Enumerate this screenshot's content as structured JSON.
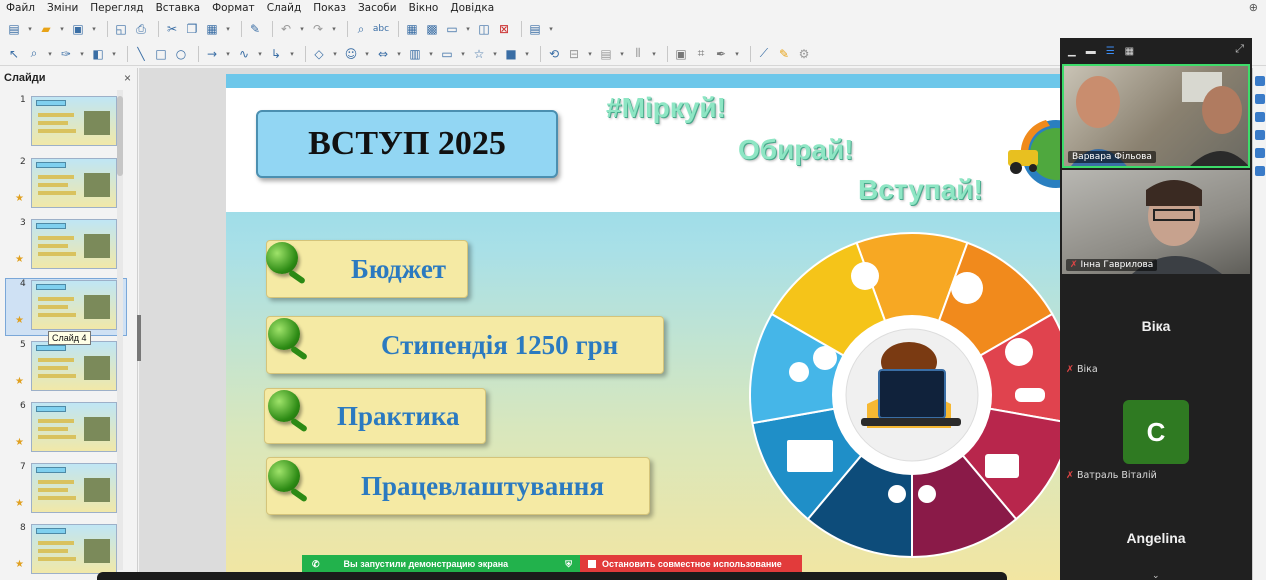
{
  "menu": {
    "items": [
      "Файл",
      "Зміни",
      "Перегляд",
      "Вставка",
      "Формат",
      "Слайд",
      "Показ",
      "Засоби",
      "Вікно",
      "Довідка"
    ]
  },
  "toolbar1_icons": [
    "new-icon",
    "open-icon",
    "save-icon",
    "export-pdf-icon",
    "print-icon",
    "cut-icon",
    "copy-icon",
    "paste-icon",
    "clone-icon",
    "undo-icon",
    "redo-icon",
    "find-icon",
    "spellcheck-icon",
    "table-icon",
    "grid-icon",
    "display-views-icon",
    "master-slide-icon",
    "delete-slide-icon",
    "slide-layout-icon"
  ],
  "toolbar2_icons": [
    "select-icon",
    "zoom-icon",
    "line-color-icon",
    "fill-color-icon",
    "line-icon",
    "rectangle-icon",
    "ellipse-icon",
    "arrow-icon",
    "curve-icon",
    "connector-icon",
    "basic-shapes-icon",
    "symbol-shapes-icon",
    "block-arrows-icon",
    "flowchart-icon",
    "callout-icon",
    "stars-icon",
    "3d-icon",
    "rotate-icon",
    "align-icon",
    "arrange-icon",
    "distribute-icon",
    "shadow-icon",
    "crop-icon",
    "filter-icon",
    "points-icon",
    "glue-icon",
    "toggle-extrusion-icon"
  ],
  "slides_panel": {
    "title": "Слайди",
    "close": "×",
    "tooltip": "Слайд 4",
    "slides": [
      {
        "num": "1",
        "active": false
      },
      {
        "num": "2",
        "active": false
      },
      {
        "num": "3",
        "active": false
      },
      {
        "num": "4",
        "active": true
      },
      {
        "num": "5",
        "active": false
      },
      {
        "num": "6",
        "active": false
      },
      {
        "num": "7",
        "active": false
      },
      {
        "num": "8",
        "active": false
      }
    ]
  },
  "slide": {
    "title": "ВСТУП 2025",
    "slogan1": "#Міркуй!",
    "slogan2": "Обирай!",
    "slogan3": "Вступай!",
    "items": [
      "Бюджет",
      "Стипендія 1250 грн",
      "Практика",
      "Працевлаштування"
    ],
    "wheel_colors": [
      "#f7a823",
      "#f18a1c",
      "#e0434e",
      "#b8264c",
      "#8a1a48",
      "#0d4c7a",
      "#1f8fc8",
      "#45b6e8",
      "#f5c419"
    ]
  },
  "sharebar": {
    "sharing_text": "Вы запустили демонстрацию экрана",
    "stop_text": "Остановить совместное использование"
  },
  "zoom": {
    "participants": [
      {
        "name": "Варвара Фільова",
        "muted": false
      },
      {
        "name": "Інна Гаврилова",
        "muted": true
      },
      {
        "name": "Віка",
        "muted": true
      },
      {
        "name": "Ватраль Віталій",
        "muted": true,
        "initial": "С"
      },
      {
        "name": "Angelina",
        "muted": false
      }
    ]
  }
}
